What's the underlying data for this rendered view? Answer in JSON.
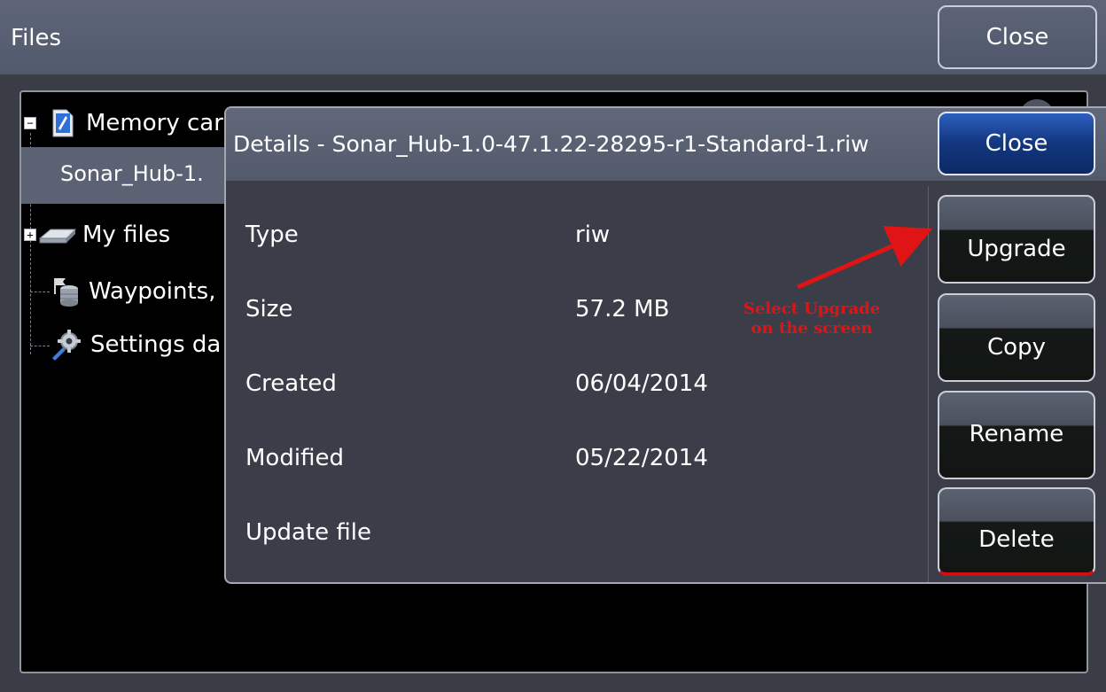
{
  "window": {
    "title": "Files",
    "close_label": "Close"
  },
  "tree": {
    "items": [
      {
        "label": "Memory car",
        "icon": "memory-card-icon",
        "expander": "−"
      },
      {
        "label": "Sonar_Hub-1.",
        "selected": true
      },
      {
        "label": "My files",
        "icon": "drive-icon",
        "expander": "+"
      },
      {
        "label": "Waypoints,",
        "icon": "database-icon"
      },
      {
        "label": "Settings da",
        "icon": "settings-icon"
      }
    ]
  },
  "dialog": {
    "title": "Details - Sonar_Hub-1.0-47.1.22-28295-r1-Standard-1.riw",
    "close_label": "Close",
    "details": [
      {
        "label": "Type",
        "value": "riw"
      },
      {
        "label": "Size",
        "value": "57.2 MB"
      },
      {
        "label": "Created",
        "value": "06/04/2014"
      },
      {
        "label": "Modified",
        "value": "05/22/2014"
      },
      {
        "label": "Update file",
        "value": ""
      }
    ],
    "actions": {
      "upgrade": "Upgrade",
      "copy": "Copy",
      "rename": "Rename",
      "delete": "Delete"
    }
  },
  "annotation": {
    "line1": "Select Upgrade",
    "line2": "on the screen",
    "color": "#e01414"
  }
}
